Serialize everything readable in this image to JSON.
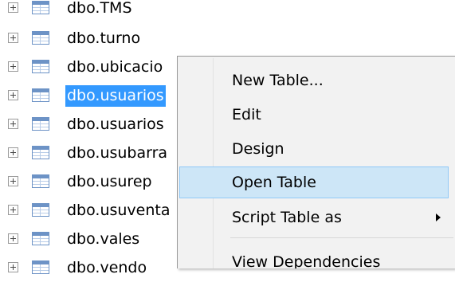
{
  "tree": {
    "items": [
      {
        "label": "dbo.TMS"
      },
      {
        "label": "dbo.turno"
      },
      {
        "label": "dbo.ubicacio"
      },
      {
        "label": "dbo.usuarios"
      },
      {
        "label": "dbo.usuarios"
      },
      {
        "label": "dbo.usubarra"
      },
      {
        "label": "dbo.usurep"
      },
      {
        "label": "dbo.usuventa"
      },
      {
        "label": "dbo.vales"
      },
      {
        "label": "dbo.vendo"
      }
    ],
    "selected_index": 3
  },
  "context_menu": {
    "items": [
      {
        "label": "New Table..."
      },
      {
        "label": "Edit"
      },
      {
        "label": "Design"
      },
      {
        "label": "Open Table"
      },
      {
        "label": "Script Table as"
      },
      {
        "label": "View Dependencies"
      }
    ],
    "highlighted_index": 3
  },
  "colors": {
    "selection": "#3399ff",
    "menu_highlight": "#cde6f7",
    "menu_highlight_border": "#91c9f7",
    "menu_background": "#f2f2f2"
  },
  "icons": {
    "expander": "plus-expander-icon",
    "table": "table-icon",
    "submenu": "chevron-right-icon"
  }
}
